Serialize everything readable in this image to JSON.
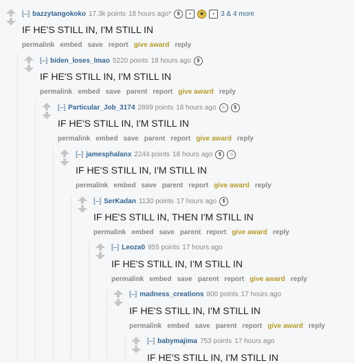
{
  "comments": [
    {
      "author": "bazzytangokoko",
      "score": "17.3k points",
      "time": "18 hours ago",
      "edited": "*",
      "body": "IF HE'S STILL IN, I'M STILL IN",
      "more_awards": "3 & 4 more",
      "buttons": [
        "permalink",
        "embed",
        "save",
        "report",
        "give award",
        "reply"
      ]
    },
    {
      "author": "biden_loses_lmao",
      "score": "5220 points",
      "time": "18 hours ago",
      "body": "IF HE'S STILL IN, I'M STILL IN",
      "buttons": [
        "permalink",
        "embed",
        "save",
        "parent",
        "report",
        "give award",
        "reply"
      ]
    },
    {
      "author": "Particular_Job_3174",
      "score": "2899 points",
      "time": "18 hours ago",
      "body": "IF HE'S STILL IN, I'M STILL IN",
      "buttons": [
        "permalink",
        "embed",
        "save",
        "parent",
        "report",
        "give award",
        "reply"
      ]
    },
    {
      "author": "jamesphalanx",
      "score": "2244 points",
      "time": "18 hours ago",
      "body": "IF HE'S STILL IN, I'M STILL IN",
      "buttons": [
        "permalink",
        "embed",
        "save",
        "parent",
        "report",
        "give award",
        "reply"
      ]
    },
    {
      "author": "SerKadan",
      "score": "1130 points",
      "time": "17 hours ago",
      "body": "IF HE'S STILL IN, THEN I'M STILL IN",
      "buttons": [
        "permalink",
        "embed",
        "save",
        "parent",
        "report",
        "give award",
        "reply"
      ]
    },
    {
      "author": "Leoza0",
      "score": "955 points",
      "time": "17 hours ago",
      "body": "IF HE'S STILL IN, I'M STILL IN",
      "buttons": [
        "permalink",
        "embed",
        "save",
        "parent",
        "report",
        "give award",
        "reply"
      ]
    },
    {
      "author": "madness_creations",
      "score": "800 points",
      "time": "17 hours ago",
      "body": "IF HE'S STILL IN, I'M STILL IN",
      "buttons": [
        "permalink",
        "embed",
        "save",
        "parent",
        "report",
        "give award",
        "reply"
      ]
    },
    {
      "author": "babymajima",
      "score": "753 points",
      "time": "17 hours ago",
      "body": "IF HE'S STILL IN, I'M STILL IN",
      "buttons": []
    }
  ],
  "collapse_label": "[–]",
  "award_icons": {
    "c0": [
      "s",
      "box",
      "gold",
      "box"
    ],
    "c1": [
      "s"
    ],
    "c2": [
      "face",
      "s"
    ],
    "c3": [
      "s",
      "face"
    ],
    "c4": [
      "s"
    ]
  }
}
